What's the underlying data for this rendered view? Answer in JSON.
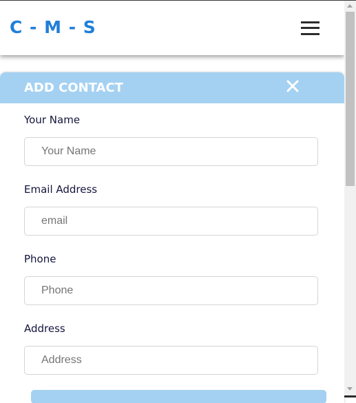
{
  "header": {
    "logo": "C - M - S",
    "menu_icon": "hamburger-menu-icon"
  },
  "modal": {
    "title": "ADD CONTACT",
    "close_icon": "close-icon",
    "fields": [
      {
        "label": "Your Name",
        "placeholder": "Your Name",
        "value": ""
      },
      {
        "label": "Email Address",
        "placeholder": "email",
        "value": ""
      },
      {
        "label": "Phone",
        "placeholder": "Phone",
        "value": ""
      },
      {
        "label": "Address",
        "placeholder": "Address",
        "value": ""
      }
    ]
  },
  "colors": {
    "brand": "#1f7fd9",
    "modal_header": "#a4d1f2",
    "label_text": "#14153d"
  }
}
